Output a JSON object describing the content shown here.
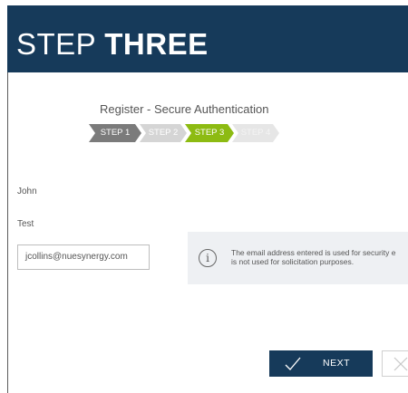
{
  "header": {
    "title_light": "STEP ",
    "title_bold": "THREE"
  },
  "wizard": {
    "heading": "Register - Secure Authentication",
    "steps": [
      "STEP 1",
      "STEP 2",
      "STEP 3",
      "STEP 4"
    ],
    "active_step": 3
  },
  "form": {
    "first_name": "John",
    "last_name": "Test",
    "email": "jcollins@nuesynergy.com"
  },
  "info": {
    "line1": "The email address entered is used for security e",
    "line2": "is not used for solicitation purposes."
  },
  "buttons": {
    "next_label": "NEXT"
  },
  "colors": {
    "header_bg": "#163a5a",
    "active_step": "#8dbb12",
    "done_step": "#7b7b7b"
  },
  "icons": {
    "info": "info-icon",
    "next": "checkmark-icon",
    "cancel": "close-icon"
  }
}
